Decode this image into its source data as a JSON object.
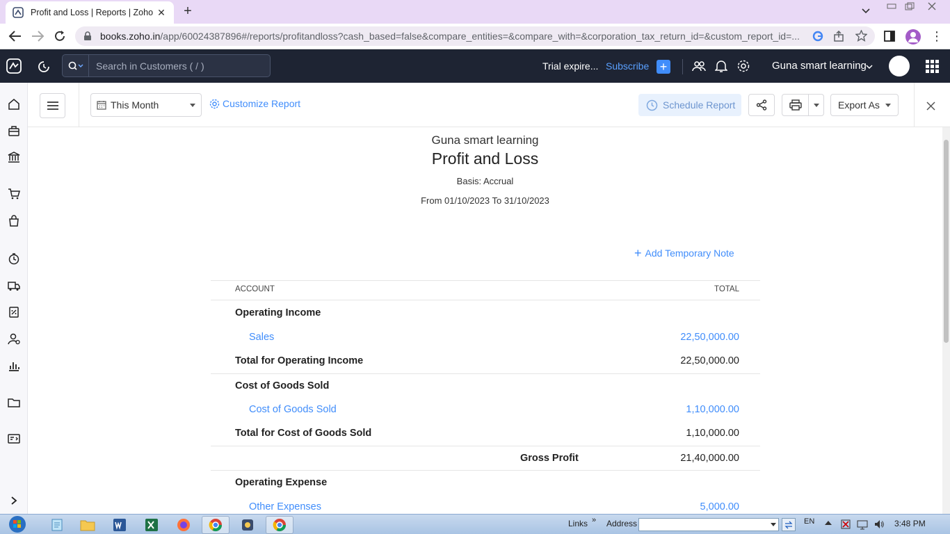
{
  "browser": {
    "tab_title": "Profit and Loss | Reports | Zoho B",
    "url_host": "books.zoho.in",
    "url_path": "/app/60024387896#/reports/profitandloss?cash_based=false&compare_entities=&compare_with=&corporation_tax_return_id=&custom_report_id=..."
  },
  "header": {
    "search_placeholder": "Search in Customers ( / )",
    "trial_text": "Trial expire...",
    "subscribe_label": "Subscribe",
    "org_name": "Guna smart learning"
  },
  "toolbar": {
    "period_label": "This Month",
    "customize_label": "Customize Report",
    "schedule_label": "Schedule Report",
    "export_label": "Export As"
  },
  "report": {
    "org": "Guna smart learning",
    "title": "Profit and Loss",
    "basis": "Basis: Accrual",
    "range": "From 01/10/2023 To 31/10/2023",
    "add_note_label": "Add Temporary Note",
    "col_account": "ACCOUNT",
    "col_total": "TOTAL",
    "operating_income": {
      "heading": "Operating Income",
      "sales_label": "Sales",
      "sales_amount": "22,50,000.00",
      "total_label": "Total for Operating Income",
      "total_amount": "22,50,000.00"
    },
    "cogs": {
      "heading": "Cost of Goods Sold",
      "item_label": "Cost of Goods Sold",
      "item_amount": "1,10,000.00",
      "total_label": "Total for Cost of Goods Sold",
      "total_amount": "1,10,000.00"
    },
    "gross_profit": {
      "label": "Gross Profit",
      "amount": "21,40,000.00"
    },
    "operating_expense": {
      "heading": "Operating Expense",
      "item_label": "Other Expenses",
      "item_amount": "5,000.00"
    }
  },
  "taskbar": {
    "links_label": "Links",
    "address_label": "Address",
    "lang": "EN",
    "time": "3:48 PM"
  },
  "colors": {
    "header_bg": "#1e2433",
    "link": "#408dfb",
    "subscribe": "#5aa0ff",
    "tab_strip": "#e9d9f6"
  }
}
